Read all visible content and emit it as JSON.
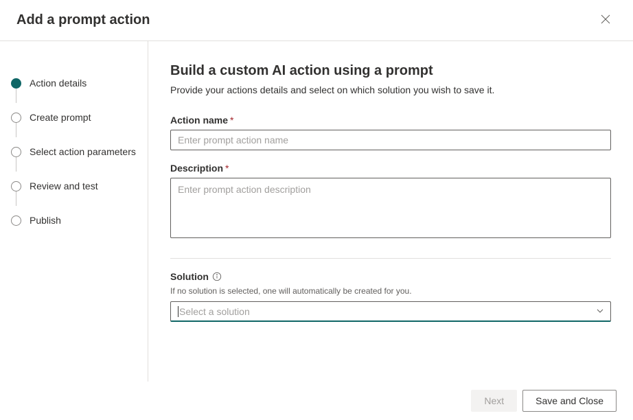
{
  "header": {
    "title": "Add a prompt action"
  },
  "sidebar": {
    "steps": [
      {
        "label": "Action details",
        "active": true
      },
      {
        "label": "Create prompt",
        "active": false
      },
      {
        "label": "Select action parameters",
        "active": false
      },
      {
        "label": "Review and test",
        "active": false
      },
      {
        "label": "Publish",
        "active": false
      }
    ]
  },
  "main": {
    "title": "Build a custom AI action using a prompt",
    "subtitle": "Provide your actions details and select on which solution you wish to save it.",
    "fields": {
      "action_name": {
        "label": "Action name",
        "required": "*",
        "placeholder": "Enter prompt action name",
        "value": ""
      },
      "description": {
        "label": "Description",
        "required": "*",
        "placeholder": "Enter prompt action description",
        "value": ""
      },
      "solution": {
        "label": "Solution",
        "helper": "If no solution is selected, one will automatically be created for you.",
        "placeholder": "Select a solution",
        "value": ""
      }
    }
  },
  "footer": {
    "next": "Next",
    "save_close": "Save and Close"
  }
}
